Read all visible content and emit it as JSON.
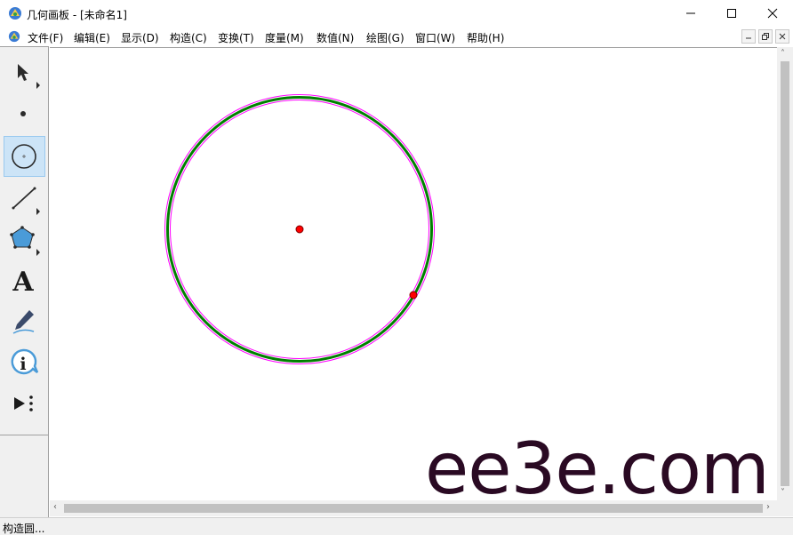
{
  "window": {
    "title": "几何画板 - [未命名1]"
  },
  "menu": {
    "items": [
      "文件(F)",
      "编辑(E)",
      "显示(D)",
      "构造(C)",
      "变换(T)",
      "度量(M)",
      "数值(N)",
      "绘图(G)",
      "窗口(W)",
      "帮助(H)"
    ]
  },
  "toolbox": {
    "tools": [
      {
        "name": "arrow-tool",
        "icon": "arrow-select-icon"
      },
      {
        "name": "point-tool",
        "icon": "point-icon"
      },
      {
        "name": "compass-tool",
        "icon": "circle-icon",
        "active": true
      },
      {
        "name": "straightedge-tool",
        "icon": "segment-icon"
      },
      {
        "name": "polygon-tool",
        "icon": "pentagon-icon"
      },
      {
        "name": "text-tool",
        "icon": "text-a-icon",
        "glyph": "A"
      },
      {
        "name": "marker-tool",
        "icon": "pen-icon"
      },
      {
        "name": "information-tool",
        "icon": "info-icon",
        "glyph": "i"
      },
      {
        "name": "custom-tool",
        "icon": "play-more-icon"
      }
    ]
  },
  "canvas": {
    "circle_color": "#008000",
    "highlight_color": "#ff00ff",
    "point_color": "#ff0000"
  },
  "status": {
    "text": "构造圆..."
  },
  "watermark": {
    "text": "ee3e.com"
  }
}
